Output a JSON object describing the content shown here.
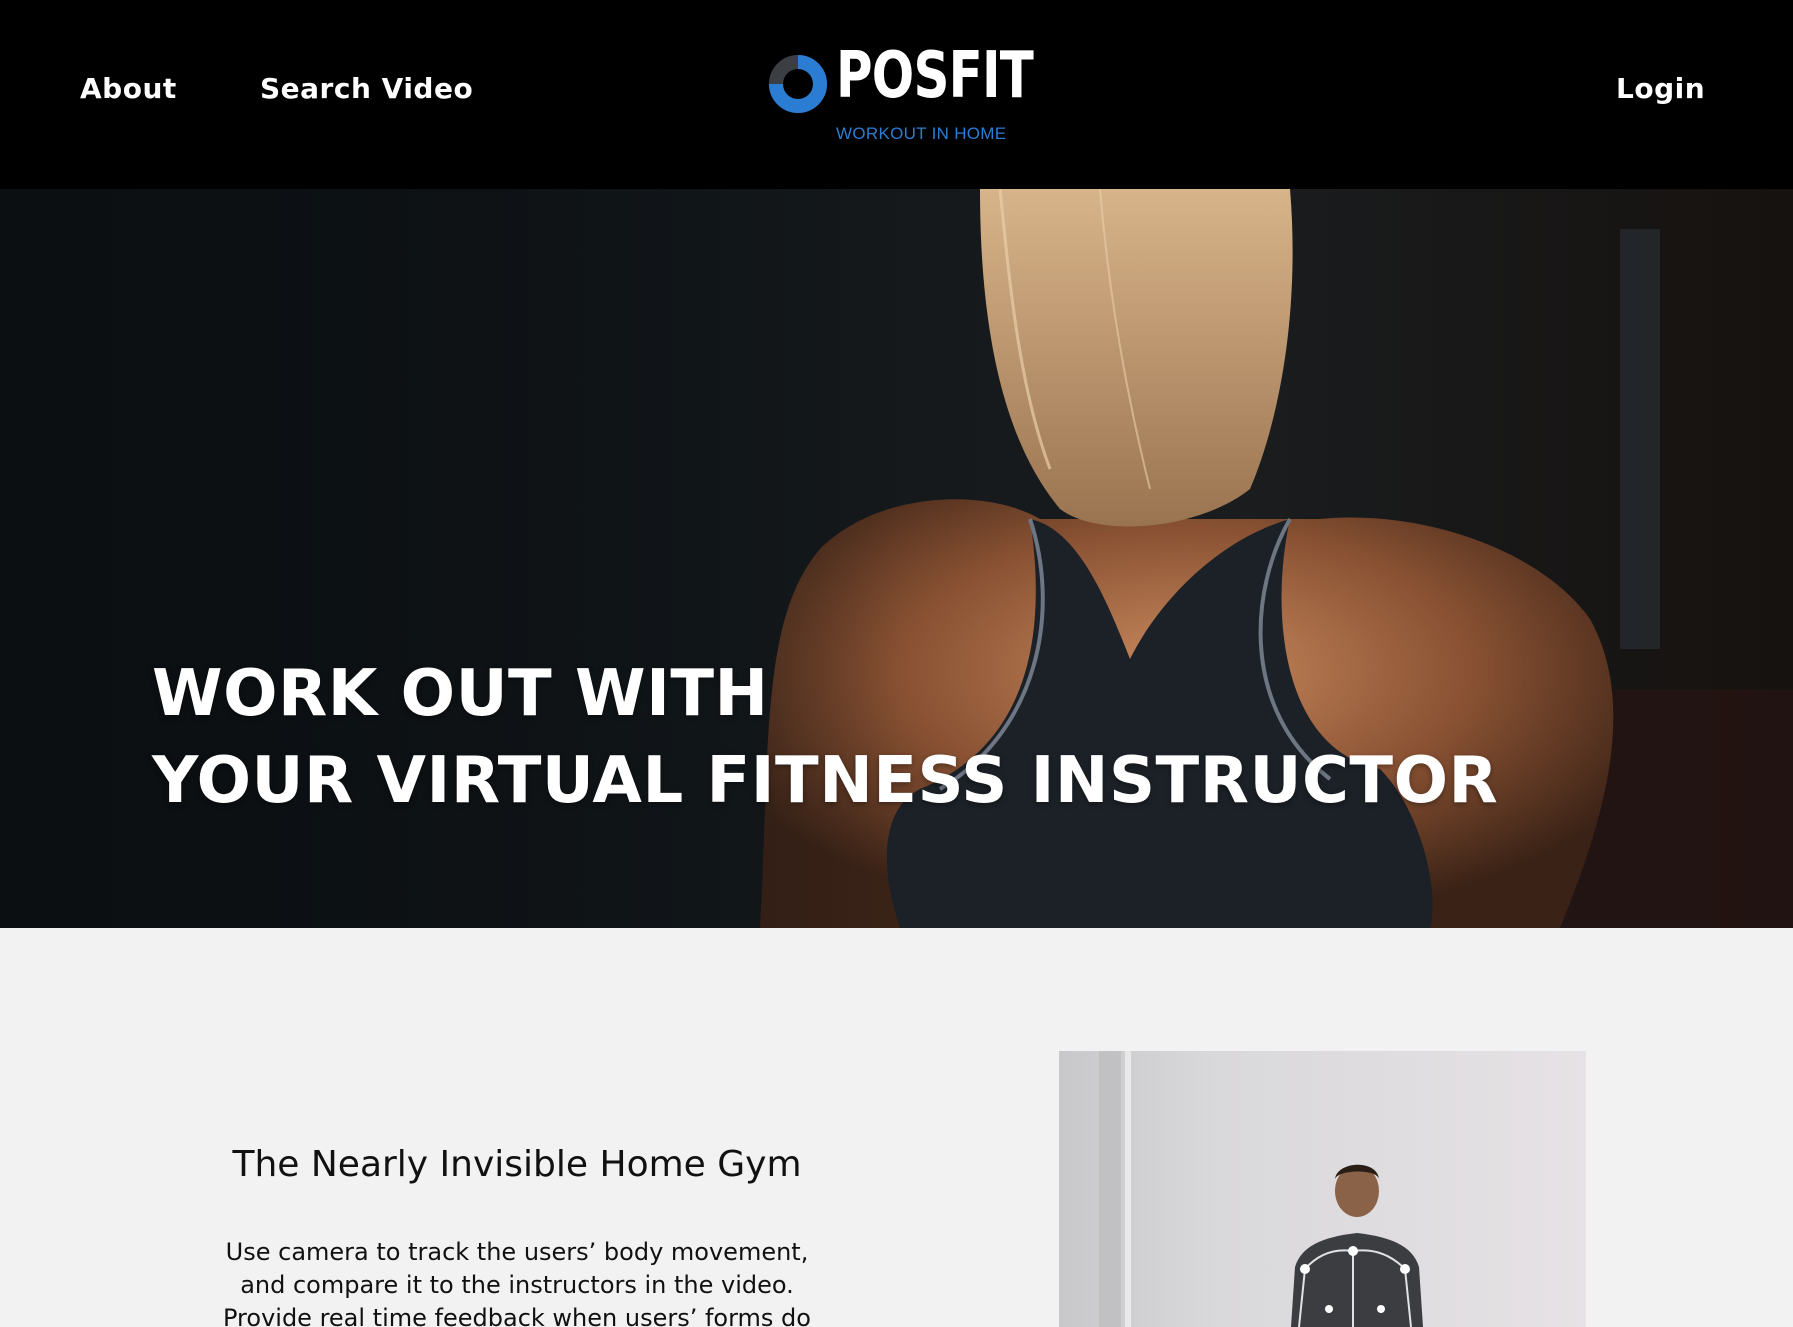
{
  "nav": {
    "about": "About",
    "search_video": "Search Video",
    "login": "Login"
  },
  "logo": {
    "name": "POSFIT",
    "tagline": "WORKOUT IN HOME",
    "ring_color": "#2b7cd3",
    "ring_dark": "#3b3f44"
  },
  "hero": {
    "line1": "WORK OUT WITH",
    "line2": "YOUR VIRTUAL FITNESS INSTRUCTOR"
  },
  "feature": {
    "heading": "The Nearly Invisible Home Gym",
    "body_line1": "Use camera to track the users’ body movement,",
    "body_line2": "and compare it to the instructors in the video.",
    "body_line3": "Provide real time feedback when users’ forms do"
  },
  "colors": {
    "header_bg": "#000000",
    "accent": "#2b7cd3",
    "section_bg": "#f2f2f2"
  }
}
